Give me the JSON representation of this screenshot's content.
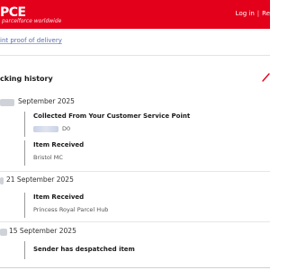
{
  "header": {
    "logo_text": "PCE",
    "logo_tagline": "parcelforce worldwide",
    "login_label": "Log in",
    "register_label": "Re",
    "brand_color": "#e3001b"
  },
  "subbar": {
    "proof_link": "int proof of delivery"
  },
  "history": {
    "title": "cking history",
    "groups": [
      {
        "date": "September 2025",
        "events": [
          {
            "title": "Collected From Your Customer Service Point",
            "detail": "D0"
          },
          {
            "title": "Item Received",
            "detail": "Bristol MC"
          }
        ]
      },
      {
        "date": "21 September 2025",
        "events": [
          {
            "title": "Item Received",
            "detail": "Princess Royal Parcel Hub"
          }
        ]
      },
      {
        "date": "15 September 2025",
        "events": [
          {
            "title": "Sender has despatched item",
            "detail": ""
          }
        ]
      }
    ]
  },
  "icons": {
    "corner": "external-link-icon"
  }
}
